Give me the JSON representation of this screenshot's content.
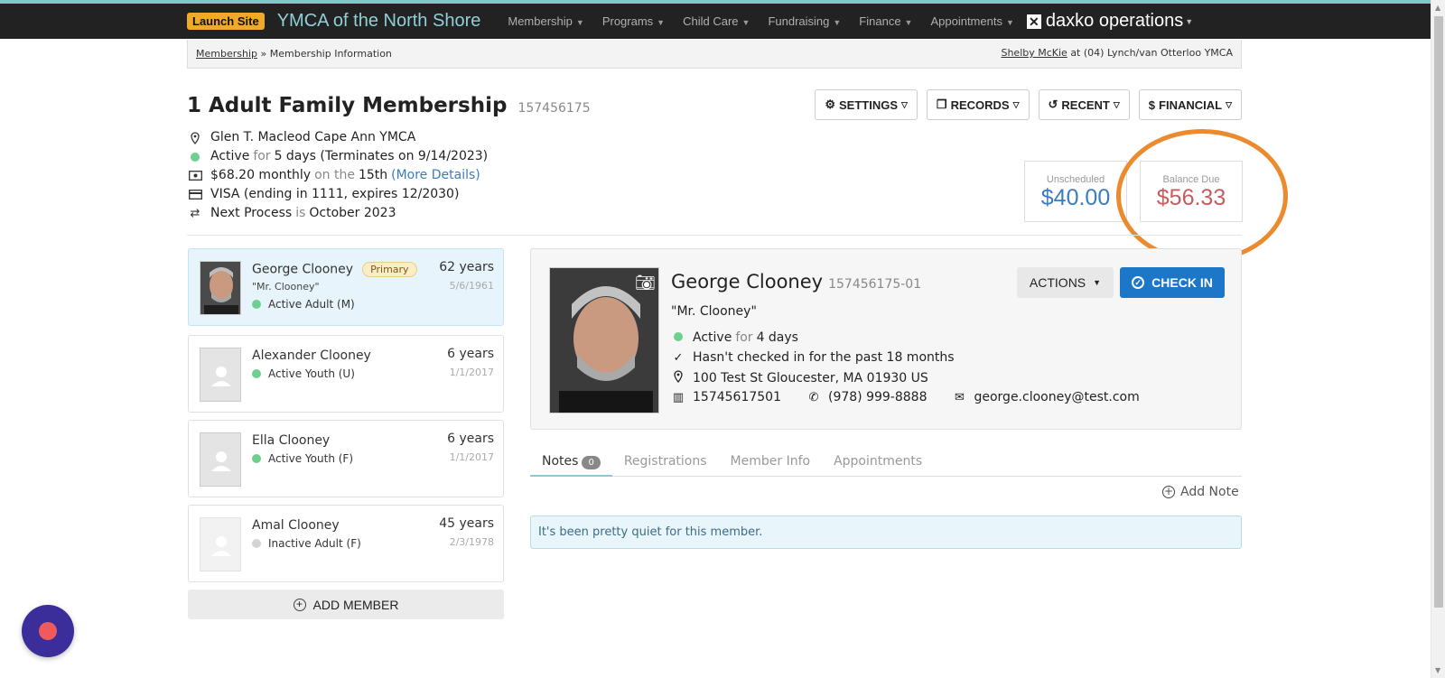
{
  "header": {
    "launch_label": "Launch Site",
    "org_name": "YMCA of the North Shore",
    "menu": [
      "Membership",
      "Programs",
      "Child Care",
      "Fundraising",
      "Finance",
      "Appointments"
    ],
    "brand": "daxko operations"
  },
  "breadcrumb": {
    "root": "Membership",
    "separator": "»",
    "current": "Membership Information",
    "user": "Shelby McKie",
    "at_text": "at (04) Lynch/van Otterloo YMCA"
  },
  "membership": {
    "title": "1 Adult Family Membership",
    "id": "157456175",
    "branch": "Glen T. Macleod Cape Ann YMCA",
    "status": "Active",
    "for_word": "for",
    "duration": "5 days (Terminates on 9/14/2023)",
    "amount": "$68.20 monthly",
    "on_the": "on the",
    "day": "15th",
    "more_details": "(More Details)",
    "card": "VISA (ending in 1111, expires 12/2030)",
    "next_label": "Next Process",
    "is_word": "is",
    "next_date": "October 2023"
  },
  "toolbar": {
    "settings": "SETTINGS",
    "records": "RECORDS",
    "recent": "RECENT",
    "financial": "FINANCIAL"
  },
  "balances": {
    "unscheduled_label": "Unscheduled",
    "unscheduled_value": "$40.00",
    "balance_label": "Balance Due",
    "balance_value": "$56.33"
  },
  "members": [
    {
      "name": "George Clooney",
      "badge": "Primary",
      "nick": "\"Mr. Clooney\"",
      "status": "Active Adult (M)",
      "age": "62 years",
      "dob": "5/6/1961",
      "active": true
    },
    {
      "name": "Alexander Clooney",
      "status": "Active Youth (U)",
      "age": "6 years",
      "dob": "1/1/2017",
      "active": true
    },
    {
      "name": "Ella Clooney",
      "status": "Active Youth (F)",
      "age": "6 years",
      "dob": "1/1/2017",
      "active": true
    },
    {
      "name": "Amal Clooney",
      "status": "Inactive Adult (F)",
      "age": "45 years",
      "dob": "2/3/1978",
      "active": false
    }
  ],
  "add_member": "ADD MEMBER",
  "detail": {
    "name": "George Clooney",
    "id": "157456175-01",
    "nick": "\"Mr. Clooney\"",
    "status": "Active",
    "for_word": "for",
    "duration": "4 days",
    "checkin_note": "Hasn't checked in for the past 18 months",
    "address": "100 Test St Gloucester, MA 01930 US",
    "barcode": "15745617501",
    "phone": "(978) 999-8888",
    "email": "george.clooney@test.com",
    "actions": "ACTIONS",
    "checkin": "CHECK IN"
  },
  "tabs": [
    {
      "label": "Notes",
      "count": "0"
    },
    {
      "label": "Registrations"
    },
    {
      "label": "Member Info"
    },
    {
      "label": "Appointments"
    }
  ],
  "add_note": "Add Note",
  "quiet_message": "It's been pretty quiet for this member.",
  "colors": {
    "accent": "#1c77c9",
    "balance": "#c85c5c",
    "unscheduled": "#3b7bbf",
    "highlight_circle": "#ec8a2e",
    "active_dot": "#6ed08e"
  }
}
